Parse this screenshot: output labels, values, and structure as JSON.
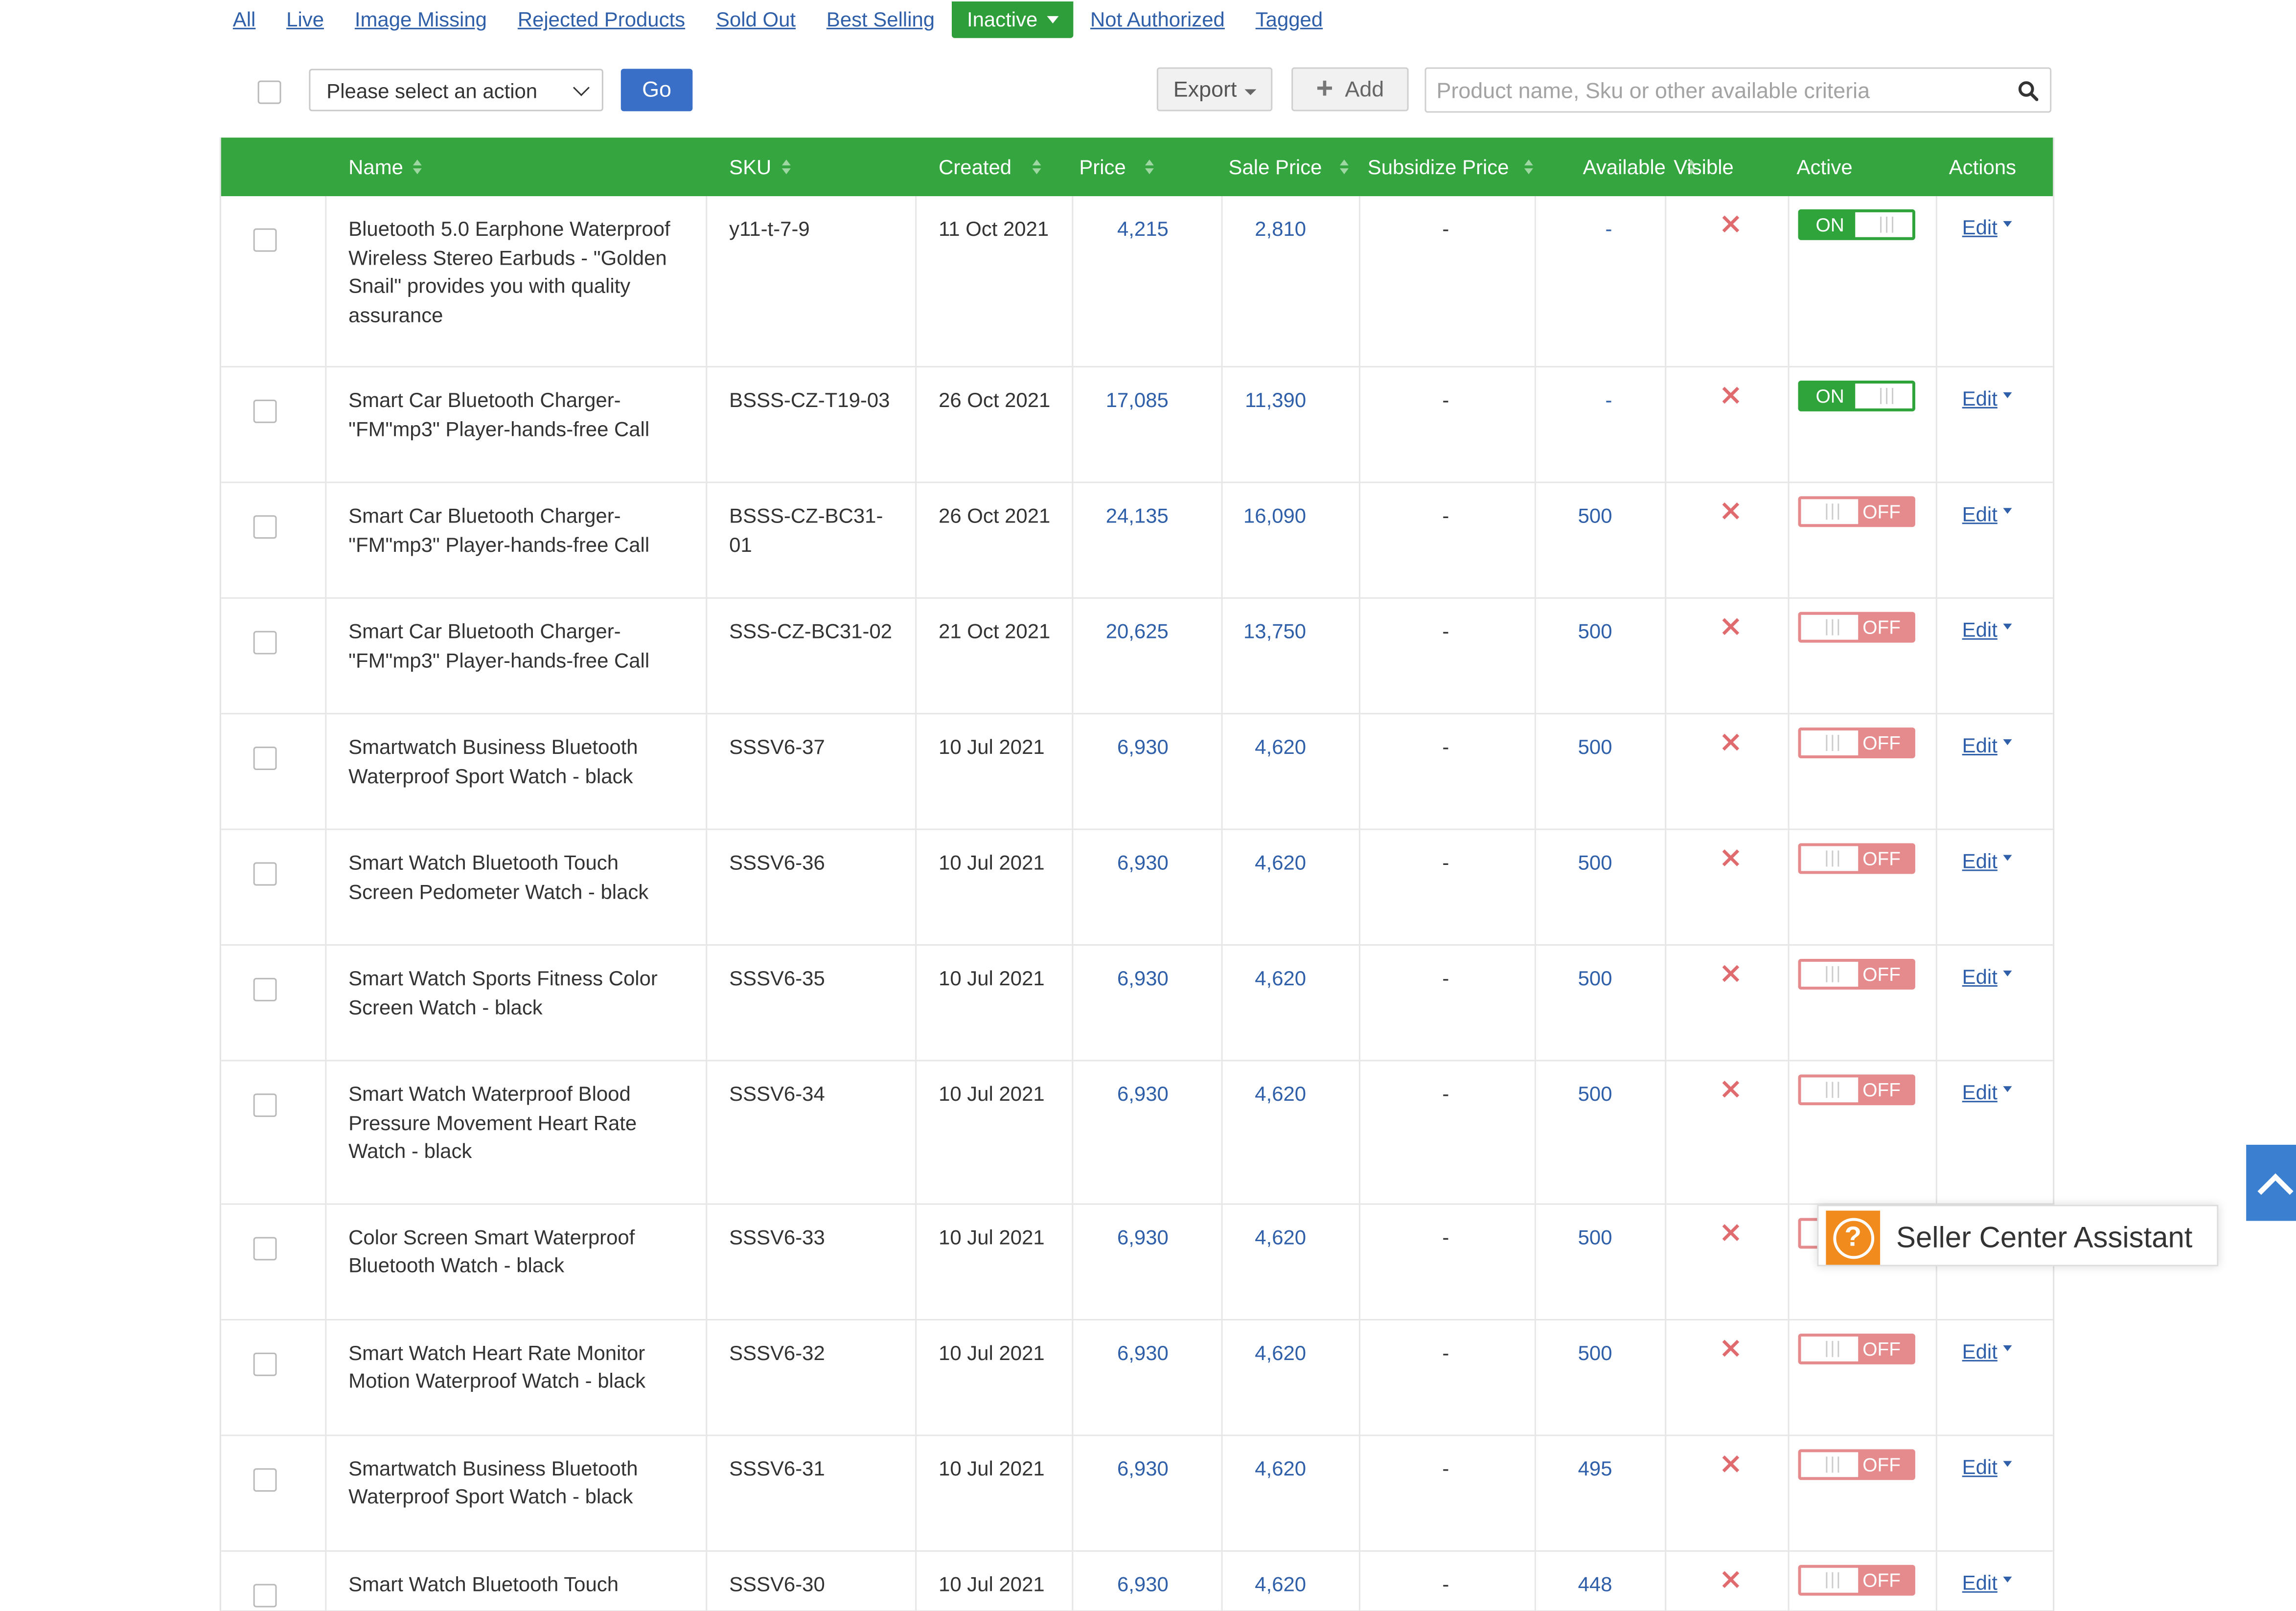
{
  "tabs": [
    {
      "label": "All",
      "active": false
    },
    {
      "label": "Live",
      "active": false
    },
    {
      "label": "Image Missing",
      "active": false
    },
    {
      "label": "Rejected Products",
      "active": false
    },
    {
      "label": "Sold Out",
      "active": false
    },
    {
      "label": "Best Selling",
      "active": false
    },
    {
      "label": "Inactive",
      "active": true
    },
    {
      "label": "Not Authorized",
      "active": false
    },
    {
      "label": "Tagged",
      "active": false
    }
  ],
  "toolbar": {
    "action_select": "Please select an action",
    "go_label": "Go",
    "export_label": "Export",
    "add_label": "Add",
    "search_placeholder": "Product name, Sku or other available criteria"
  },
  "table": {
    "headers": {
      "name": "Name",
      "sku": "SKU",
      "created": "Created",
      "price": "Price",
      "sale_price": "Sale Price",
      "subsidize_price": "Subsidize Price",
      "available": "Available",
      "visible": "Visible",
      "active": "Active",
      "actions": "Actions"
    },
    "rows": [
      {
        "name": [
          "Bluetooth 5.0 Earphone Waterproof",
          "Wireless Stereo Earbuds - \"Golden",
          "Snail\" provides you with quality",
          "assurance"
        ],
        "sku": [
          "y11-t-7-9"
        ],
        "created": "11 Oct 2021",
        "price": "4,215",
        "sale_price": "2,810",
        "subsidize": "-",
        "available": "-",
        "active": true
      },
      {
        "name": [
          "Smart Car Bluetooth Charger-",
          "\"FM\"mp3\" Player-hands-free Call"
        ],
        "sku": [
          "BSSS-CZ-T19-03"
        ],
        "created": "26 Oct 2021",
        "price": "17,085",
        "sale_price": "11,390",
        "subsidize": "-",
        "available": "-",
        "active": true
      },
      {
        "name": [
          "Smart Car Bluetooth Charger-",
          "\"FM\"mp3\" Player-hands-free Call"
        ],
        "sku": [
          "BSSS-CZ-BC31-",
          "01"
        ],
        "created": "26 Oct 2021",
        "price": "24,135",
        "sale_price": "16,090",
        "subsidize": "-",
        "available": "500",
        "active": false
      },
      {
        "name": [
          "Smart Car Bluetooth Charger-",
          "\"FM\"mp3\" Player-hands-free Call"
        ],
        "sku": [
          "SSS-CZ-BC31-02"
        ],
        "created": "21 Oct 2021",
        "price": "20,625",
        "sale_price": "13,750",
        "subsidize": "-",
        "available": "500",
        "active": false
      },
      {
        "name": [
          "Smartwatch Business Bluetooth",
          "Waterproof Sport Watch - black"
        ],
        "sku": [
          "SSSV6-37"
        ],
        "created": "10 Jul 2021",
        "price": "6,930",
        "sale_price": "4,620",
        "subsidize": "-",
        "available": "500",
        "active": false
      },
      {
        "name": [
          "Smart Watch Bluetooth Touch",
          "Screen Pedometer Watch - black"
        ],
        "sku": [
          "SSSV6-36"
        ],
        "created": "10 Jul 2021",
        "price": "6,930",
        "sale_price": "4,620",
        "subsidize": "-",
        "available": "500",
        "active": false
      },
      {
        "name": [
          "Smart Watch Sports Fitness Color",
          "Screen Watch - black"
        ],
        "sku": [
          "SSSV6-35"
        ],
        "created": "10 Jul 2021",
        "price": "6,930",
        "sale_price": "4,620",
        "subsidize": "-",
        "available": "500",
        "active": false
      },
      {
        "name": [
          "Smart Watch Waterproof Blood",
          "Pressure Movement Heart Rate",
          "Watch - black"
        ],
        "sku": [
          "SSSV6-34"
        ],
        "created": "10 Jul 2021",
        "price": "6,930",
        "sale_price": "4,620",
        "subsidize": "-",
        "available": "500",
        "active": false
      },
      {
        "name": [
          "Color Screen Smart Waterproof",
          "Bluetooth Watch - black"
        ],
        "sku": [
          "SSSV6-33"
        ],
        "created": "10 Jul 2021",
        "price": "6,930",
        "sale_price": "4,620",
        "subsidize": "-",
        "available": "500",
        "active": false
      },
      {
        "name": [
          "Smart Watch Heart Rate Monitor",
          "Motion Waterproof Watch - black"
        ],
        "sku": [
          "SSSV6-32"
        ],
        "created": "10 Jul 2021",
        "price": "6,930",
        "sale_price": "4,620",
        "subsidize": "-",
        "available": "500",
        "active": false
      },
      {
        "name": [
          "Smartwatch Business Bluetooth",
          "Waterproof Sport Watch - black"
        ],
        "sku": [
          "SSSV6-31"
        ],
        "created": "10 Jul 2021",
        "price": "6,930",
        "sale_price": "4,620",
        "subsidize": "-",
        "available": "495",
        "active": false
      },
      {
        "name": [
          "Smart Watch Bluetooth Touch"
        ],
        "sku": [
          "SSSV6-30"
        ],
        "created": "10 Jul 2021",
        "price": "6,930",
        "sale_price": "4,620",
        "subsidize": "-",
        "available": "448",
        "active": false
      }
    ],
    "toggle_on_label": "ON",
    "toggle_off_label": "OFF",
    "edit_label": "Edit",
    "visible_icon": "x-icon"
  },
  "assistant": {
    "label": "Seller Center Assistant",
    "icon": "question-icon"
  },
  "colors": {
    "accent_green": "#35a53f",
    "link_blue": "#2f5fa8",
    "off_red": "#e58b8d",
    "assistant_orange": "#f28b1e"
  }
}
